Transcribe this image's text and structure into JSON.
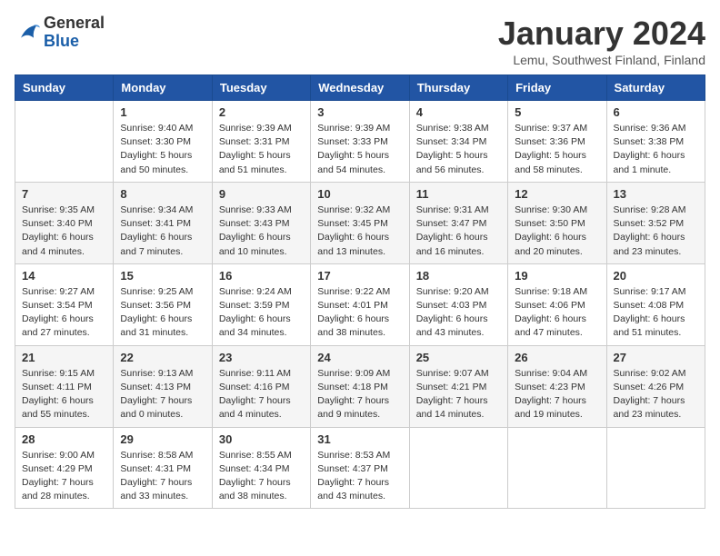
{
  "logo": {
    "general": "General",
    "blue": "Blue"
  },
  "header": {
    "month": "January 2024",
    "location": "Lemu, Southwest Finland, Finland"
  },
  "weekdays": [
    "Sunday",
    "Monday",
    "Tuesday",
    "Wednesday",
    "Thursday",
    "Friday",
    "Saturday"
  ],
  "weeks": [
    [
      {
        "day": "",
        "info": ""
      },
      {
        "day": "1",
        "info": "Sunrise: 9:40 AM\nSunset: 3:30 PM\nDaylight: 5 hours\nand 50 minutes."
      },
      {
        "day": "2",
        "info": "Sunrise: 9:39 AM\nSunset: 3:31 PM\nDaylight: 5 hours\nand 51 minutes."
      },
      {
        "day": "3",
        "info": "Sunrise: 9:39 AM\nSunset: 3:33 PM\nDaylight: 5 hours\nand 54 minutes."
      },
      {
        "day": "4",
        "info": "Sunrise: 9:38 AM\nSunset: 3:34 PM\nDaylight: 5 hours\nand 56 minutes."
      },
      {
        "day": "5",
        "info": "Sunrise: 9:37 AM\nSunset: 3:36 PM\nDaylight: 5 hours\nand 58 minutes."
      },
      {
        "day": "6",
        "info": "Sunrise: 9:36 AM\nSunset: 3:38 PM\nDaylight: 6 hours\nand 1 minute."
      }
    ],
    [
      {
        "day": "7",
        "info": "Sunrise: 9:35 AM\nSunset: 3:40 PM\nDaylight: 6 hours\nand 4 minutes."
      },
      {
        "day": "8",
        "info": "Sunrise: 9:34 AM\nSunset: 3:41 PM\nDaylight: 6 hours\nand 7 minutes."
      },
      {
        "day": "9",
        "info": "Sunrise: 9:33 AM\nSunset: 3:43 PM\nDaylight: 6 hours\nand 10 minutes."
      },
      {
        "day": "10",
        "info": "Sunrise: 9:32 AM\nSunset: 3:45 PM\nDaylight: 6 hours\nand 13 minutes."
      },
      {
        "day": "11",
        "info": "Sunrise: 9:31 AM\nSunset: 3:47 PM\nDaylight: 6 hours\nand 16 minutes."
      },
      {
        "day": "12",
        "info": "Sunrise: 9:30 AM\nSunset: 3:50 PM\nDaylight: 6 hours\nand 20 minutes."
      },
      {
        "day": "13",
        "info": "Sunrise: 9:28 AM\nSunset: 3:52 PM\nDaylight: 6 hours\nand 23 minutes."
      }
    ],
    [
      {
        "day": "14",
        "info": "Sunrise: 9:27 AM\nSunset: 3:54 PM\nDaylight: 6 hours\nand 27 minutes."
      },
      {
        "day": "15",
        "info": "Sunrise: 9:25 AM\nSunset: 3:56 PM\nDaylight: 6 hours\nand 31 minutes."
      },
      {
        "day": "16",
        "info": "Sunrise: 9:24 AM\nSunset: 3:59 PM\nDaylight: 6 hours\nand 34 minutes."
      },
      {
        "day": "17",
        "info": "Sunrise: 9:22 AM\nSunset: 4:01 PM\nDaylight: 6 hours\nand 38 minutes."
      },
      {
        "day": "18",
        "info": "Sunrise: 9:20 AM\nSunset: 4:03 PM\nDaylight: 6 hours\nand 43 minutes."
      },
      {
        "day": "19",
        "info": "Sunrise: 9:18 AM\nSunset: 4:06 PM\nDaylight: 6 hours\nand 47 minutes."
      },
      {
        "day": "20",
        "info": "Sunrise: 9:17 AM\nSunset: 4:08 PM\nDaylight: 6 hours\nand 51 minutes."
      }
    ],
    [
      {
        "day": "21",
        "info": "Sunrise: 9:15 AM\nSunset: 4:11 PM\nDaylight: 6 hours\nand 55 minutes."
      },
      {
        "day": "22",
        "info": "Sunrise: 9:13 AM\nSunset: 4:13 PM\nDaylight: 7 hours\nand 0 minutes."
      },
      {
        "day": "23",
        "info": "Sunrise: 9:11 AM\nSunset: 4:16 PM\nDaylight: 7 hours\nand 4 minutes."
      },
      {
        "day": "24",
        "info": "Sunrise: 9:09 AM\nSunset: 4:18 PM\nDaylight: 7 hours\nand 9 minutes."
      },
      {
        "day": "25",
        "info": "Sunrise: 9:07 AM\nSunset: 4:21 PM\nDaylight: 7 hours\nand 14 minutes."
      },
      {
        "day": "26",
        "info": "Sunrise: 9:04 AM\nSunset: 4:23 PM\nDaylight: 7 hours\nand 19 minutes."
      },
      {
        "day": "27",
        "info": "Sunrise: 9:02 AM\nSunset: 4:26 PM\nDaylight: 7 hours\nand 23 minutes."
      }
    ],
    [
      {
        "day": "28",
        "info": "Sunrise: 9:00 AM\nSunset: 4:29 PM\nDaylight: 7 hours\nand 28 minutes."
      },
      {
        "day": "29",
        "info": "Sunrise: 8:58 AM\nSunset: 4:31 PM\nDaylight: 7 hours\nand 33 minutes."
      },
      {
        "day": "30",
        "info": "Sunrise: 8:55 AM\nSunset: 4:34 PM\nDaylight: 7 hours\nand 38 minutes."
      },
      {
        "day": "31",
        "info": "Sunrise: 8:53 AM\nSunset: 4:37 PM\nDaylight: 7 hours\nand 43 minutes."
      },
      {
        "day": "",
        "info": ""
      },
      {
        "day": "",
        "info": ""
      },
      {
        "day": "",
        "info": ""
      }
    ]
  ]
}
